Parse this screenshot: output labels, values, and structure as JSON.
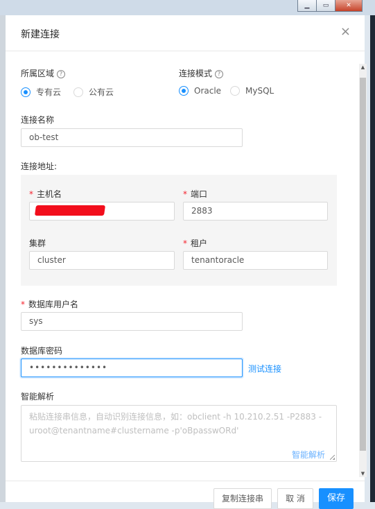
{
  "dialog": {
    "title": "新建连接",
    "close": "×"
  },
  "region": {
    "label": "所属区域",
    "options": [
      "专有云",
      "公有云"
    ],
    "selected": "专有云"
  },
  "mode": {
    "label": "连接模式",
    "options": [
      "Oracle",
      "MySQL"
    ],
    "selected": "Oracle"
  },
  "name": {
    "label": "连接名称",
    "value": "ob-test"
  },
  "address": {
    "label": "连接地址:",
    "host": {
      "label": "主机名",
      "value": ""
    },
    "port": {
      "label": "端口",
      "value": "2883"
    },
    "cluster": {
      "label": "集群",
      "value": "cluster"
    },
    "tenant": {
      "label": "租户",
      "value": "tenantoracle"
    }
  },
  "db_user": {
    "label": "数据库用户名",
    "value": "sys"
  },
  "db_password": {
    "label": "数据库密码",
    "value": "••••••••••••••",
    "test_link": "测试连接"
  },
  "smart_parse": {
    "label": "智能解析",
    "placeholder": "粘贴连接串信息，自动识别连接信息，如：obclient -h 10.210.2.51 -P2883 -uroot@tenantname#clustername -p'oBpasswORd'",
    "link": "智能解析"
  },
  "footer": {
    "copy": "复制连接串",
    "cancel": "取 消",
    "save": "保存"
  },
  "colors": {
    "primary": "#1890ff",
    "required": "#f5222d"
  }
}
